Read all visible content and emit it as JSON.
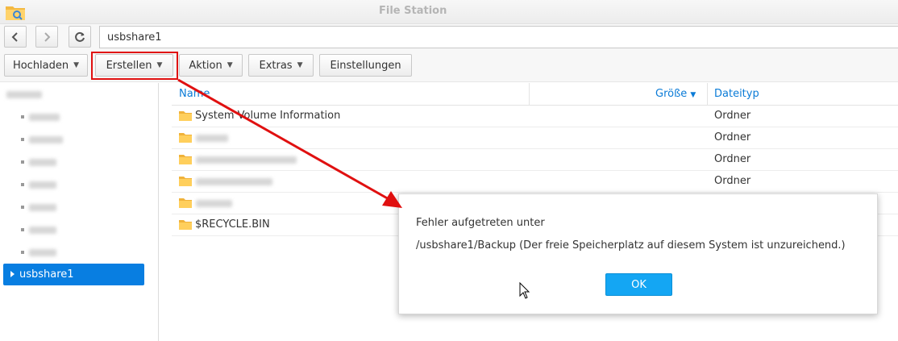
{
  "window": {
    "title": "File Station"
  },
  "nav": {
    "path": "usbshare1"
  },
  "toolbar": {
    "upload_label": "Hochladen",
    "create_label": "Erstellen",
    "action_label": "Aktion",
    "extras_label": "Extras",
    "settings_label": "Einstellungen"
  },
  "sidebar": {
    "selected_label": "usbshare1"
  },
  "grid": {
    "columns": {
      "name": "Name",
      "size": "Größe",
      "type": "Dateityp"
    },
    "rows": [
      {
        "name": "System Volume Information",
        "type": "Ordner"
      },
      {
        "name": "",
        "type": "Ordner"
      },
      {
        "name": "",
        "type": "Ordner"
      },
      {
        "name": "",
        "type": "Ordner"
      },
      {
        "name": "",
        "type": ""
      },
      {
        "name": "$RECYCLE.BIN",
        "type": ""
      }
    ]
  },
  "dialog": {
    "line1": "Fehler aufgetreten unter",
    "line2": "/usbshare1/Backup (Der freie Speicherplatz auf diesem System ist unzureichend.)",
    "ok_label": "OK"
  },
  "colors": {
    "accent": "#087ee1",
    "ok_button": "#14a6f3",
    "annotation": "#e01010",
    "header_text": "#0a7bd7"
  },
  "icons": [
    "file-station-icon",
    "back-icon",
    "forward-icon",
    "refresh-icon",
    "folder-icon",
    "caret-down-icon",
    "cursor-icon"
  ]
}
